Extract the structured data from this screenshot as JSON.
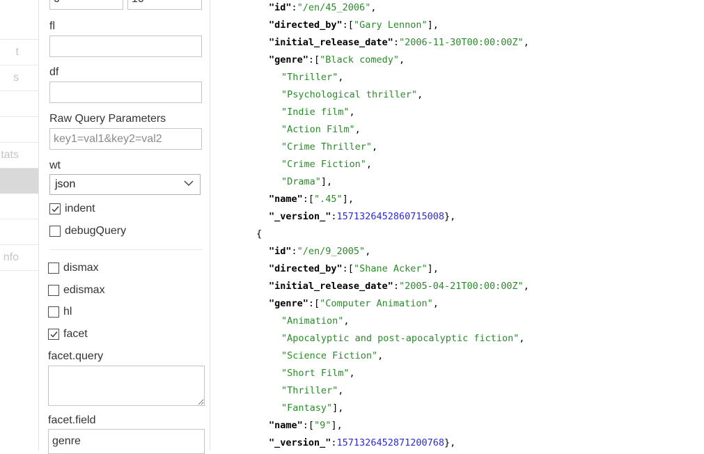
{
  "nav": {
    "items": [
      {
        "label": ""
      },
      {
        "label": "t"
      },
      {
        "label": "s"
      },
      {
        "label": ""
      },
      {
        "label": ""
      },
      {
        "label": "tats"
      },
      {
        "label": ""
      },
      {
        "label": ""
      },
      {
        "label": ""
      },
      {
        "label": "nfo"
      }
    ]
  },
  "form": {
    "top_inputs": [
      {
        "value": "0"
      },
      {
        "value": "10"
      }
    ],
    "fl": {
      "label": "fl",
      "value": ""
    },
    "df": {
      "label": "df",
      "value": ""
    },
    "raw": {
      "label": "Raw Query Parameters",
      "placeholder": "key1=val1&key2=val2"
    },
    "wt": {
      "label": "wt",
      "value": "json"
    },
    "indent": {
      "label": "indent",
      "checked": true
    },
    "debugQuery": {
      "label": "debugQuery",
      "checked": false
    },
    "dismax": {
      "label": "dismax",
      "checked": false
    },
    "edismax": {
      "label": "edismax",
      "checked": false
    },
    "hl": {
      "label": "hl",
      "checked": false
    },
    "facet": {
      "label": "facet",
      "checked": true
    },
    "facet_query": {
      "label": "facet.query",
      "value": ""
    },
    "facet_field": {
      "label": "facet.field",
      "value": "genre"
    }
  },
  "response": {
    "lines": [
      {
        "indent": 5,
        "parts": [
          {
            "t": "\"id\"",
            "c": "k"
          },
          {
            "t": ":",
            "c": "p"
          },
          {
            "t": "\"/en/45_2006\"",
            "c": "s"
          },
          {
            "t": ",",
            "c": "p"
          }
        ]
      },
      {
        "indent": 5,
        "parts": [
          {
            "t": "\"directed_by\"",
            "c": "k"
          },
          {
            "t": ":[",
            "c": "p"
          },
          {
            "t": "\"Gary Lennon\"",
            "c": "s"
          },
          {
            "t": "],",
            "c": "p"
          }
        ]
      },
      {
        "indent": 5,
        "parts": [
          {
            "t": "\"initial_release_date\"",
            "c": "k"
          },
          {
            "t": ":",
            "c": "p"
          },
          {
            "t": "\"2006-11-30T00:00:00Z\"",
            "c": "s"
          },
          {
            "t": ",",
            "c": "p"
          }
        ]
      },
      {
        "indent": 5,
        "parts": [
          {
            "t": "\"genre\"",
            "c": "k"
          },
          {
            "t": ":[",
            "c": "p"
          },
          {
            "t": "\"Black comedy\"",
            "c": "s"
          },
          {
            "t": ",",
            "c": "p"
          }
        ]
      },
      {
        "indent": 7,
        "parts": [
          {
            "t": "\"Thriller\"",
            "c": "s"
          },
          {
            "t": ",",
            "c": "p"
          }
        ]
      },
      {
        "indent": 7,
        "parts": [
          {
            "t": "\"Psychological thriller\"",
            "c": "s"
          },
          {
            "t": ",",
            "c": "p"
          }
        ]
      },
      {
        "indent": 7,
        "parts": [
          {
            "t": "\"Indie film\"",
            "c": "s"
          },
          {
            "t": ",",
            "c": "p"
          }
        ]
      },
      {
        "indent": 7,
        "parts": [
          {
            "t": "\"Action Film\"",
            "c": "s"
          },
          {
            "t": ",",
            "c": "p"
          }
        ]
      },
      {
        "indent": 7,
        "parts": [
          {
            "t": "\"Crime Thriller\"",
            "c": "s"
          },
          {
            "t": ",",
            "c": "p"
          }
        ]
      },
      {
        "indent": 7,
        "parts": [
          {
            "t": "\"Crime Fiction\"",
            "c": "s"
          },
          {
            "t": ",",
            "c": "p"
          }
        ]
      },
      {
        "indent": 7,
        "parts": [
          {
            "t": "\"Drama\"",
            "c": "s"
          },
          {
            "t": "],",
            "c": "p"
          }
        ]
      },
      {
        "indent": 5,
        "parts": [
          {
            "t": "\"name\"",
            "c": "k"
          },
          {
            "t": ":[",
            "c": "p"
          },
          {
            "t": "\".45\"",
            "c": "s"
          },
          {
            "t": "],",
            "c": "p"
          }
        ]
      },
      {
        "indent": 5,
        "parts": [
          {
            "t": "\"_version_\"",
            "c": "k"
          },
          {
            "t": ":",
            "c": "p"
          },
          {
            "t": "1571326452860715008",
            "c": "n"
          },
          {
            "t": "},",
            "c": "p"
          }
        ]
      },
      {
        "indent": 3,
        "parts": [
          {
            "t": "{",
            "c": "p"
          }
        ]
      },
      {
        "indent": 5,
        "parts": [
          {
            "t": "\"id\"",
            "c": "k"
          },
          {
            "t": ":",
            "c": "p"
          },
          {
            "t": "\"/en/9_2005\"",
            "c": "s"
          },
          {
            "t": ",",
            "c": "p"
          }
        ]
      },
      {
        "indent": 5,
        "parts": [
          {
            "t": "\"directed_by\"",
            "c": "k"
          },
          {
            "t": ":[",
            "c": "p"
          },
          {
            "t": "\"Shane Acker\"",
            "c": "s"
          },
          {
            "t": "],",
            "c": "p"
          }
        ]
      },
      {
        "indent": 5,
        "parts": [
          {
            "t": "\"initial_release_date\"",
            "c": "k"
          },
          {
            "t": ":",
            "c": "p"
          },
          {
            "t": "\"2005-04-21T00:00:00Z\"",
            "c": "s"
          },
          {
            "t": ",",
            "c": "p"
          }
        ]
      },
      {
        "indent": 5,
        "parts": [
          {
            "t": "\"genre\"",
            "c": "k"
          },
          {
            "t": ":[",
            "c": "p"
          },
          {
            "t": "\"Computer Animation\"",
            "c": "s"
          },
          {
            "t": ",",
            "c": "p"
          }
        ]
      },
      {
        "indent": 7,
        "parts": [
          {
            "t": "\"Animation\"",
            "c": "s"
          },
          {
            "t": ",",
            "c": "p"
          }
        ]
      },
      {
        "indent": 7,
        "parts": [
          {
            "t": "\"Apocalyptic and post-apocalyptic fiction\"",
            "c": "s"
          },
          {
            "t": ",",
            "c": "p"
          }
        ]
      },
      {
        "indent": 7,
        "parts": [
          {
            "t": "\"Science Fiction\"",
            "c": "s"
          },
          {
            "t": ",",
            "c": "p"
          }
        ]
      },
      {
        "indent": 7,
        "parts": [
          {
            "t": "\"Short Film\"",
            "c": "s"
          },
          {
            "t": ",",
            "c": "p"
          }
        ]
      },
      {
        "indent": 7,
        "parts": [
          {
            "t": "\"Thriller\"",
            "c": "s"
          },
          {
            "t": ",",
            "c": "p"
          }
        ]
      },
      {
        "indent": 7,
        "parts": [
          {
            "t": "\"Fantasy\"",
            "c": "s"
          },
          {
            "t": "],",
            "c": "p"
          }
        ]
      },
      {
        "indent": 5,
        "parts": [
          {
            "t": "\"name\"",
            "c": "k"
          },
          {
            "t": ":[",
            "c": "p"
          },
          {
            "t": "\"9\"",
            "c": "s"
          },
          {
            "t": "],",
            "c": "p"
          }
        ]
      },
      {
        "indent": 5,
        "parts": [
          {
            "t": "\"_version_\"",
            "c": "k"
          },
          {
            "t": ":",
            "c": "p"
          },
          {
            "t": "1571326452871200768",
            "c": "n"
          },
          {
            "t": "},",
            "c": "p"
          }
        ]
      }
    ]
  },
  "colors": {
    "key": "#000000",
    "string": "#2a8a2a",
    "number": "#2a2ad8",
    "active_nav": "#d9d9d9"
  },
  "icons": {
    "checkbox_checked": "check-icon",
    "select": "chevron-down-icon"
  }
}
